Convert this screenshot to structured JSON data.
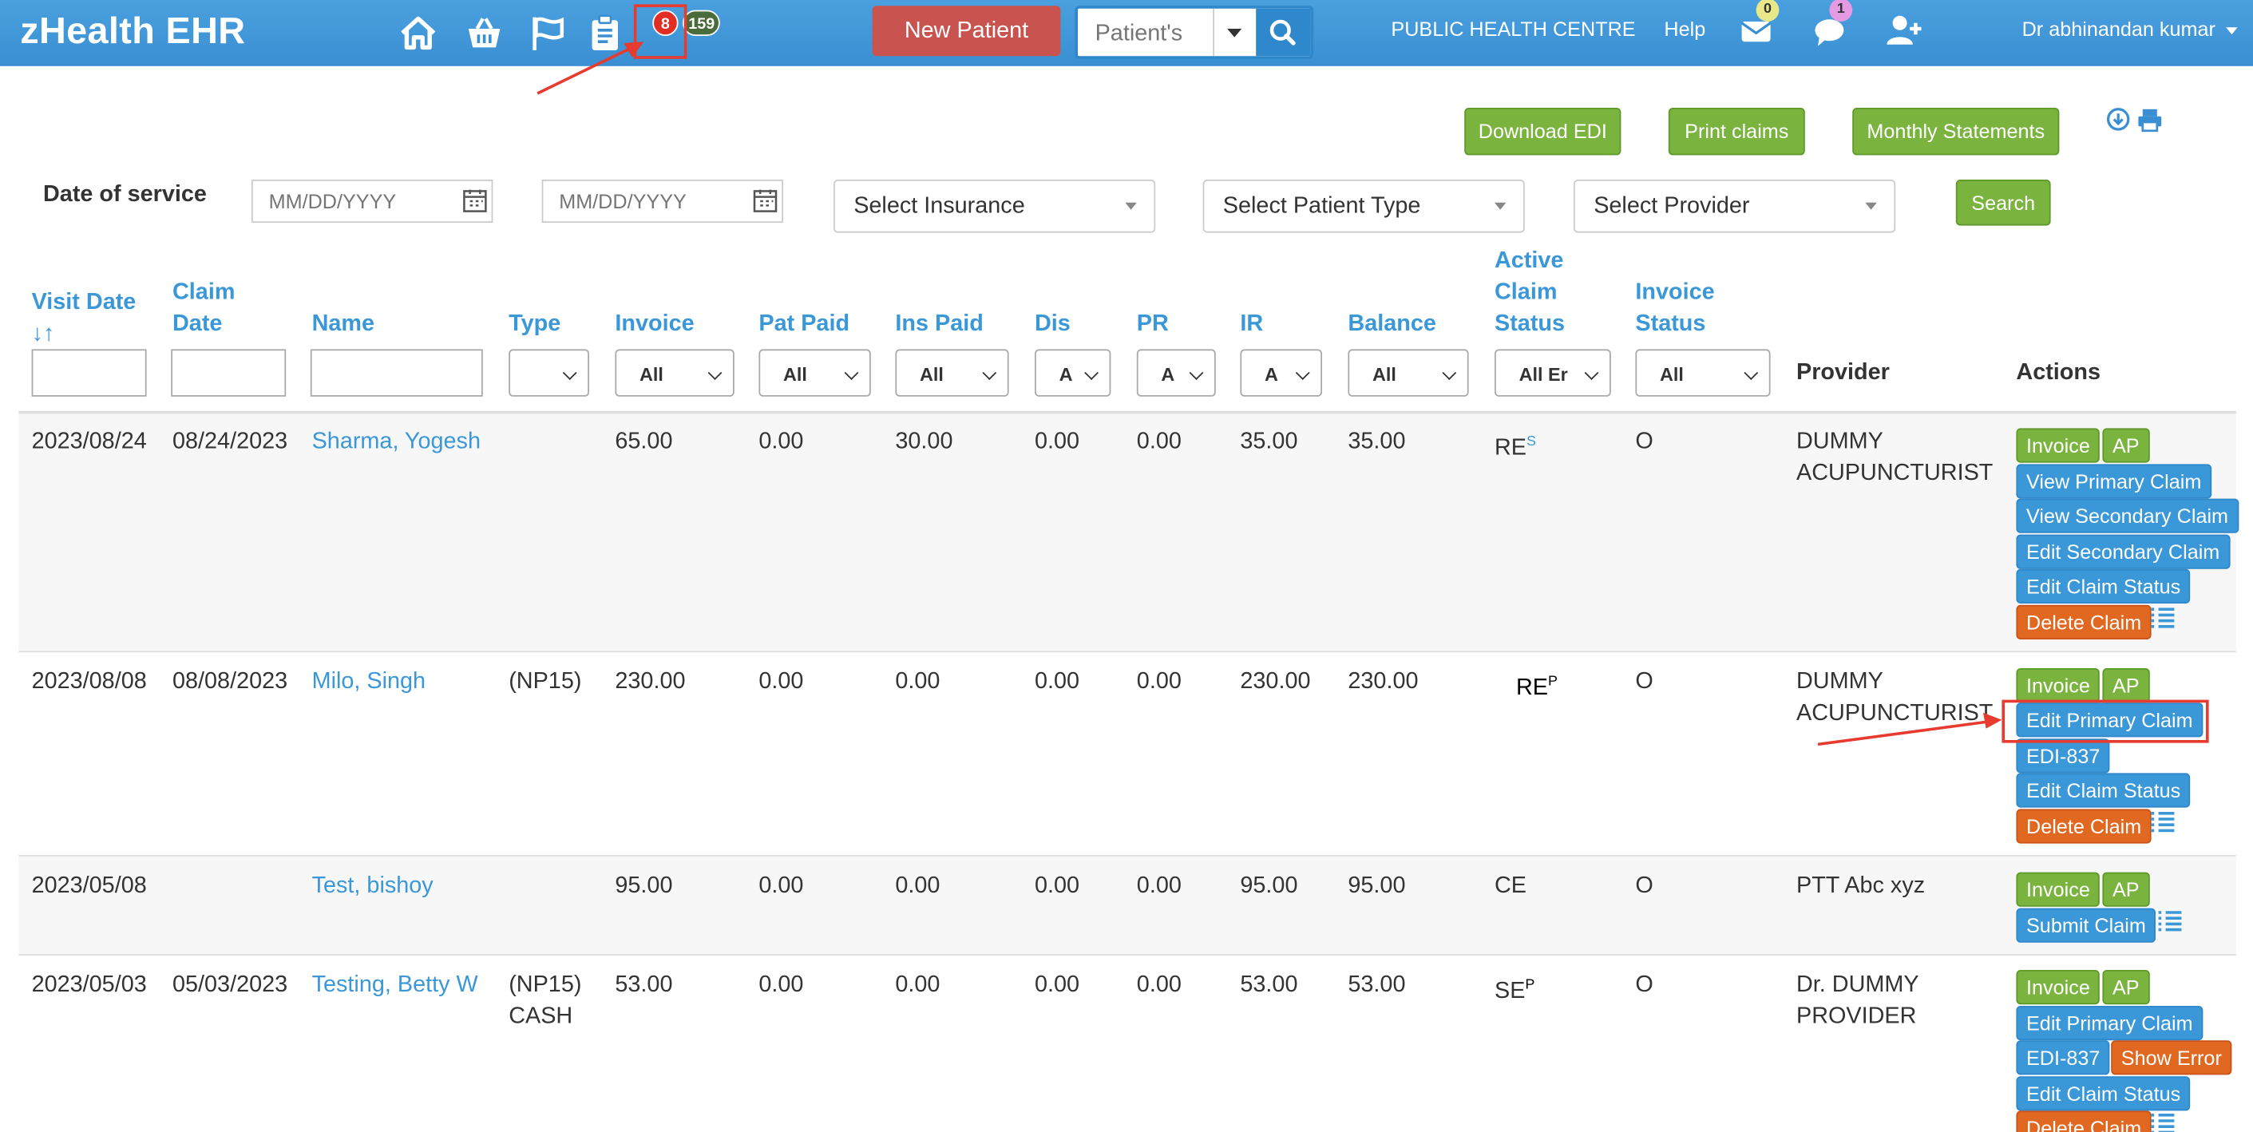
{
  "header": {
    "brand": "zHealth EHR",
    "notif_count": "8",
    "tasks_count": "159",
    "new_patient_label": "New Patient",
    "search_placeholder": "Patient's",
    "clinic_name": "PUBLIC HEALTH CENTRE",
    "help_label": "Help",
    "mail_count": "0",
    "chat_count": "1",
    "user_name": "Dr abhinandan kumar"
  },
  "toolbar": {
    "download_edi": "Download EDI",
    "print_claims": "Print claims",
    "monthly_statements": "Monthly Statements"
  },
  "filters": {
    "date_of_service_label": "Date of service",
    "date_placeholder": "MM/DD/YYYY",
    "select_insurance": "Select Insurance",
    "select_patient_type": "Select Patient Type",
    "select_provider": "Select Provider",
    "search_label": "Search"
  },
  "table": {
    "columns": {
      "visit_date_1": "Visit Date",
      "visit_date_2": "↓↑",
      "claim_date_1": "Claim",
      "claim_date_2": "Date",
      "name": "Name",
      "type": "Type",
      "invoice": "Invoice",
      "pat_paid": "Pat Paid",
      "ins_paid": "Ins Paid",
      "dis": "Dis",
      "pr": "PR",
      "ir": "IR",
      "balance": "Balance",
      "active_claim_1": "Active",
      "active_claim_2": "Claim",
      "active_claim_3": "Status",
      "invoice_status_1": "Invoice",
      "invoice_status_2": "Status",
      "provider": "Provider",
      "actions": "Actions"
    },
    "filter_values": {
      "invoice": "All",
      "pat_paid": "All",
      "ins_paid": "All",
      "dis": "A",
      "pr": "A",
      "ir": "A",
      "balance": "All",
      "active_claim": "All Er",
      "invoice_status": "All"
    },
    "rows": [
      {
        "visit_date": "2023/08/24",
        "claim_date": "08/24/2023",
        "name": "Sharma, Yogesh",
        "type": "",
        "type2": "",
        "invoice": "65.00",
        "pat_paid": "0.00",
        "ins_paid": "30.00",
        "dis": "0.00",
        "pr": "0.00",
        "ir": "35.00",
        "balance": "35.00",
        "claim_status": "RE",
        "claim_status_sup": "S",
        "invoice_status": "O",
        "provider_1": "DUMMY",
        "provider_2": "ACUPUNCTURIST",
        "actions": [
          "Invoice",
          "AP",
          "View Primary Claim",
          "View Secondary Claim",
          "Edit Secondary Claim",
          "Edit Claim Status",
          "Delete Claim"
        ]
      },
      {
        "visit_date": "2023/08/08",
        "claim_date": "08/08/2023",
        "name": "Milo, Singh",
        "type": "(NP15)",
        "type2": "",
        "invoice": "230.00",
        "pat_paid": "0.00",
        "ins_paid": "0.00",
        "dis": "0.00",
        "pr": "0.00",
        "ir": "230.00",
        "balance": "230.00",
        "claim_status": "RE",
        "claim_status_sup": "P",
        "invoice_status": "O",
        "provider_1": "DUMMY",
        "provider_2": "ACUPUNCTURIST",
        "actions": [
          "Invoice",
          "AP",
          "Edit Primary Claim",
          "EDI-837",
          "Edit Claim Status",
          "Delete Claim"
        ]
      },
      {
        "visit_date": "2023/05/08",
        "claim_date": "",
        "name": "Test, bishoy",
        "type": "",
        "type2": "",
        "invoice": "95.00",
        "pat_paid": "0.00",
        "ins_paid": "0.00",
        "dis": "0.00",
        "pr": "0.00",
        "ir": "95.00",
        "balance": "95.00",
        "claim_status": "CE",
        "claim_status_sup": "",
        "invoice_status": "O",
        "provider_1": "PTT Abc xyz",
        "provider_2": "",
        "actions": [
          "Invoice",
          "AP",
          "Submit Claim"
        ]
      },
      {
        "visit_date": "2023/05/03",
        "claim_date": "05/03/2023",
        "name": "Testing, Betty W",
        "type": "(NP15)",
        "type2": "CASH",
        "invoice": "53.00",
        "pat_paid": "0.00",
        "ins_paid": "0.00",
        "dis": "0.00",
        "pr": "0.00",
        "ir": "53.00",
        "balance": "53.00",
        "claim_status": "SE",
        "claim_status_sup": "P",
        "invoice_status": "O",
        "provider_1": "Dr. DUMMY",
        "provider_2": "PROVIDER",
        "actions": [
          "Invoice",
          "AP",
          "Edit Primary Claim",
          "EDI-837",
          "Show Error",
          "Edit Claim Status",
          "Delete Claim"
        ]
      }
    ]
  },
  "colors": {
    "header_blue": "#3a8fd3",
    "link_blue": "#3a97d8",
    "green": "#7bb33f",
    "orange": "#e06820",
    "annotation_red": "#e63b2e"
  }
}
